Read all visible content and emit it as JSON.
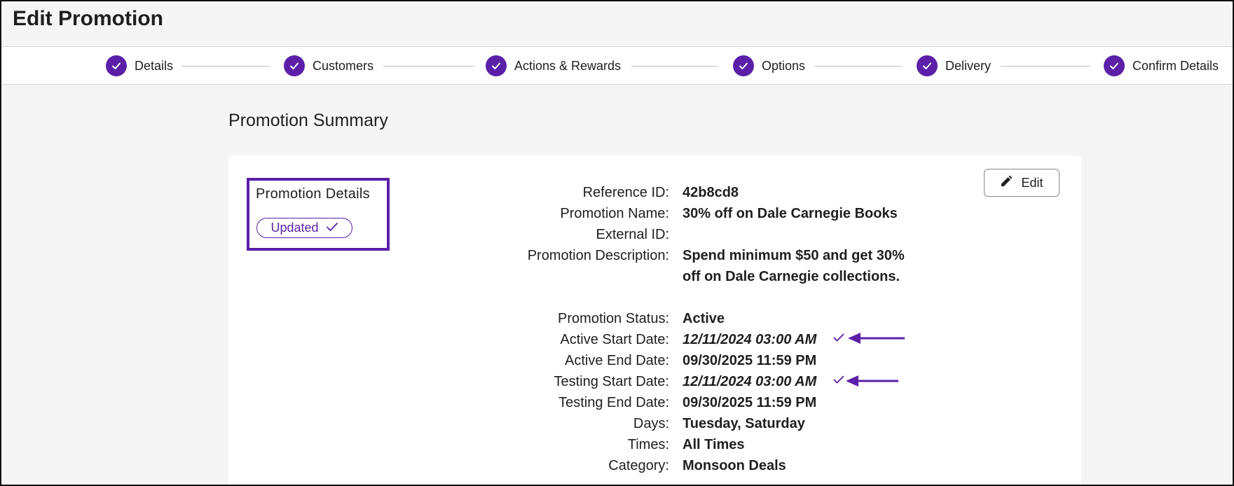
{
  "page": {
    "title": "Edit Promotion"
  },
  "stepper": {
    "steps": [
      {
        "label": "Details",
        "state": "complete"
      },
      {
        "label": "Customers",
        "state": "complete"
      },
      {
        "label": "Actions & Rewards",
        "state": "complete"
      },
      {
        "label": "Options",
        "state": "complete"
      },
      {
        "label": "Delivery",
        "state": "complete"
      },
      {
        "label": "Confirm Details",
        "state": "complete"
      }
    ],
    "icon": "check-circle-icon"
  },
  "summary": {
    "title": "Promotion Summary",
    "section_title": "Promotion Details",
    "badge_label": "Updated",
    "badge_icon": "check-icon",
    "edit_label": "Edit",
    "edit_icon": "pencil-icon",
    "fields": [
      {
        "label": "Reference ID:",
        "value": "42b8cd8"
      },
      {
        "label": "Promotion Name:",
        "value": "30% off on Dale Carnegie Books"
      },
      {
        "label": "External ID:",
        "value": ""
      },
      {
        "label": "Promotion Description:",
        "value": "Spend minimum $50 and get 30% off on Dale Carnegie collections."
      },
      {
        "label": "Promotion Status:",
        "value": "Active"
      },
      {
        "label": "Active Start Date:",
        "value": "12/11/2024 03:00 AM",
        "updated": true
      },
      {
        "label": "Active End Date:",
        "value": "09/30/2025 11:59 PM"
      },
      {
        "label": "Testing Start Date:",
        "value": "12/11/2024 03:00 AM",
        "updated": true
      },
      {
        "label": "Testing End Date:",
        "value": "09/30/2025 11:59 PM"
      },
      {
        "label": "Days:",
        "value": "Tuesday, Saturday"
      },
      {
        "label": "Times:",
        "value": "All Times"
      },
      {
        "label": "Category:",
        "value": "Monsoon Deals"
      }
    ]
  },
  "colors": {
    "accent": "#5b1fa8",
    "text": "#1f1f1f",
    "background": "#f5f5f5",
    "card": "#ffffff"
  }
}
